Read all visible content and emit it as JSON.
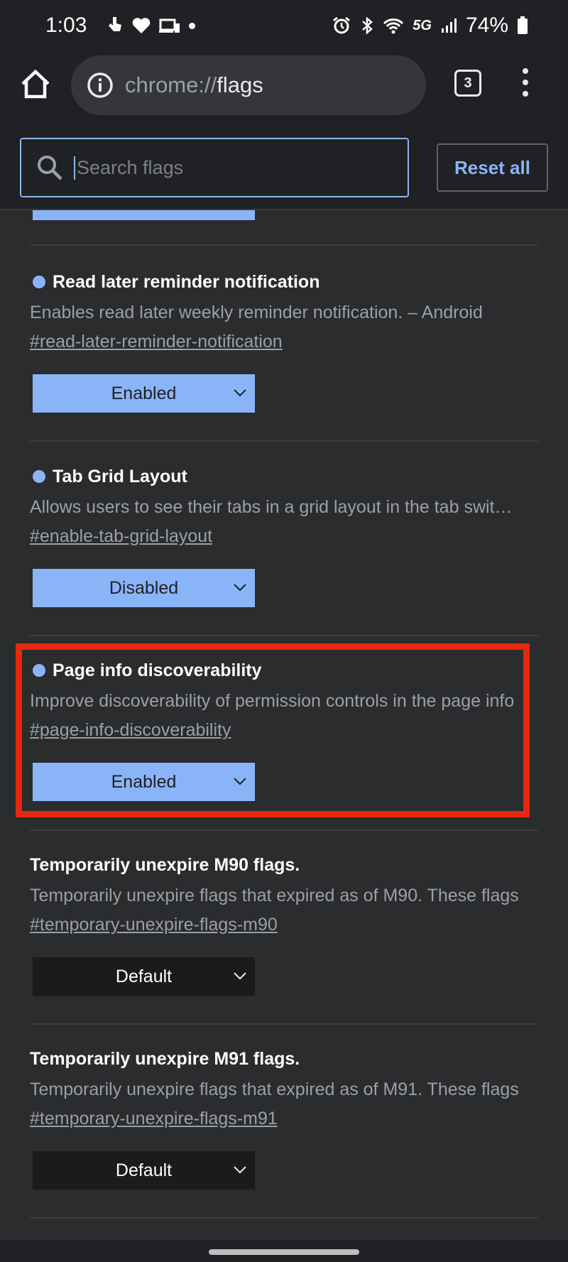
{
  "status_bar": {
    "time": "1:03",
    "network": "5G",
    "battery": "74%"
  },
  "toolbar": {
    "url_scheme": "chrome://",
    "url_host": "flags",
    "tab_count": "3"
  },
  "search": {
    "placeholder": "Search flags",
    "value": "",
    "reset_label": "Reset all"
  },
  "flags": [
    {
      "title": "Read later reminder notification",
      "description": "Enables read later weekly reminder notification. – Android",
      "link": "#read-later-reminder-notification",
      "value": "Enabled",
      "modified": true
    },
    {
      "title": "Tab Grid Layout",
      "description": "Allows users to see their tabs in a grid layout in the tab switcher",
      "link": "#enable-tab-grid-layout",
      "value": "Disabled",
      "modified": true
    },
    {
      "title": "Page info discoverability",
      "description": "Improve discoverability of permission controls in the page info",
      "link": "#page-info-discoverability",
      "value": "Enabled",
      "modified": true,
      "highlighted": true
    },
    {
      "title": "Temporarily unexpire M90 flags.",
      "description": "Temporarily unexpire flags that expired as of M90. These flags",
      "link": "#temporary-unexpire-flags-m90",
      "value": "Default",
      "modified": false
    },
    {
      "title": "Temporarily unexpire M91 flags.",
      "description": "Temporarily unexpire flags that expired as of M91. These flags",
      "link": "#temporary-unexpire-flags-m91",
      "value": "Default",
      "modified": false
    }
  ],
  "colors": {
    "accent": "#8ab4f8",
    "highlight_border": "#e8270d",
    "background": "#2b2c2e",
    "toolbar": "#202124"
  }
}
